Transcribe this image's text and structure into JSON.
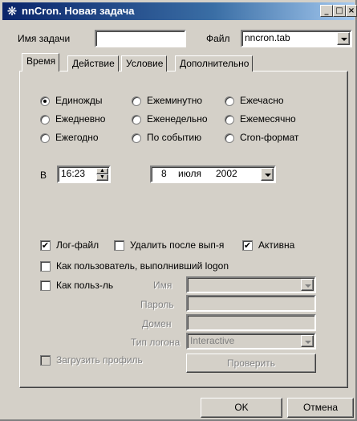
{
  "window": {
    "title": "nnCron. Новая задача",
    "minimize": "_",
    "maximize": "□",
    "close": "×"
  },
  "task": {
    "name_label": "Имя задачи",
    "name_value": "",
    "file_label": "Файл",
    "file_value": "nncron.tab"
  },
  "tabs": [
    {
      "label": "Время",
      "active": true
    },
    {
      "label": "Действие",
      "active": false
    },
    {
      "label": "Условие",
      "active": false
    },
    {
      "label": "Дополнительно",
      "active": false
    }
  ],
  "schedule": {
    "options": [
      {
        "label": "Единожды",
        "selected": true
      },
      {
        "label": "Ежеминутно",
        "selected": false
      },
      {
        "label": "Ежечасно",
        "selected": false
      },
      {
        "label": "Ежедневно",
        "selected": false
      },
      {
        "label": "Еженедельно",
        "selected": false
      },
      {
        "label": "Ежемесячно",
        "selected": false
      },
      {
        "label": "Ежегодно",
        "selected": false
      },
      {
        "label": "По событию",
        "selected": false
      },
      {
        "label": "Cron-формат",
        "selected": false
      }
    ]
  },
  "time": {
    "at_label": "В",
    "time_value": "16:23",
    "date_day": "8",
    "date_month": "июля",
    "date_year": "2002"
  },
  "options": {
    "log_file": {
      "label": "Лог-файл",
      "checked": true
    },
    "delete_after": {
      "label": "Удалить после вып-я",
      "checked": false
    },
    "active": {
      "label": "Активна",
      "checked": true
    },
    "as_logged_user": {
      "label": "Как пользователь, выполнивший logon",
      "checked": false
    },
    "as_user": {
      "label": "Как польз-ль",
      "checked": false
    },
    "load_profile": {
      "label": "Загрузить профиль",
      "checked": false
    }
  },
  "credentials": {
    "name_label": "Имя",
    "password_label": "Пароль",
    "domain_label": "Домен",
    "logon_type_label": "Тип логона",
    "logon_type_value": "Interactive"
  },
  "buttons": {
    "check": "Проверить",
    "ok": "OK",
    "cancel": "Отмена"
  }
}
